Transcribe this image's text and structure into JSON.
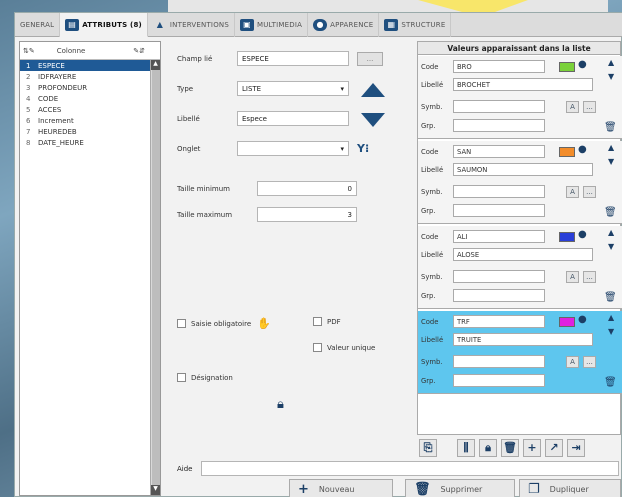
{
  "tabs": [
    {
      "label": "GENERAL",
      "icon": "none"
    },
    {
      "label": "ATTRIBUTS (8)",
      "icon": "attributes-icon"
    },
    {
      "label": "INTERVENTIONS",
      "icon": "triangle-icon"
    },
    {
      "label": "MULTIMEDIA",
      "icon": "image-icon"
    },
    {
      "label": "APPARENCE",
      "icon": "palette-icon"
    },
    {
      "label": "STRUCTURE",
      "icon": "grid-icon"
    }
  ],
  "columns": {
    "header": "Colonne",
    "items": [
      {
        "n": "1",
        "label": "ESPECE"
      },
      {
        "n": "2",
        "label": "IDFRAYERE"
      },
      {
        "n": "3",
        "label": "PROFONDEUR"
      },
      {
        "n": "4",
        "label": "CODE"
      },
      {
        "n": "5",
        "label": "ACCES"
      },
      {
        "n": "6",
        "label": "Increment"
      },
      {
        "n": "7",
        "label": "HEUREDEB"
      },
      {
        "n": "8",
        "label": "DATE_HEURE"
      }
    ]
  },
  "form": {
    "champ_label": "Champ lié",
    "champ_value": "ESPECE",
    "type_label": "Type",
    "type_value": "LISTE",
    "libelle_label": "Libellé",
    "libelle_value": "Espece",
    "onglet_label": "Onglet",
    "onglet_value": "",
    "taille_min_label": "Taille minimum",
    "taille_min_value": "0",
    "taille_max_label": "Taille maximum",
    "taille_max_value": "3",
    "saisie_label": "Saisie obligatoire",
    "pdf_label": "PDF",
    "valeur_unique_label": "Valeur unique",
    "designation_label": "Désignation",
    "aide_label": "Aide"
  },
  "values_panel": {
    "title": "Valeurs apparaissant dans la liste",
    "code_label": "Code",
    "libelle_label": "Libellé",
    "symb_label": "Symb.",
    "grp_label": "Grp.",
    "entries": [
      {
        "code": "BRO",
        "libelle": "BROCHET",
        "color": "#7ad13a"
      },
      {
        "code": "SAN",
        "libelle": "SAUMON",
        "color": "#f28c2a"
      },
      {
        "code": "ALI",
        "libelle": "ALOSE",
        "color": "#2a3fd8"
      },
      {
        "code": "TRF",
        "libelle": "TRUITE",
        "color": "#e020e0"
      }
    ]
  },
  "buttons": {
    "nouveau": "Nouveau",
    "supprimer": "Supprimer",
    "dupliquer": "Dupliquer"
  }
}
